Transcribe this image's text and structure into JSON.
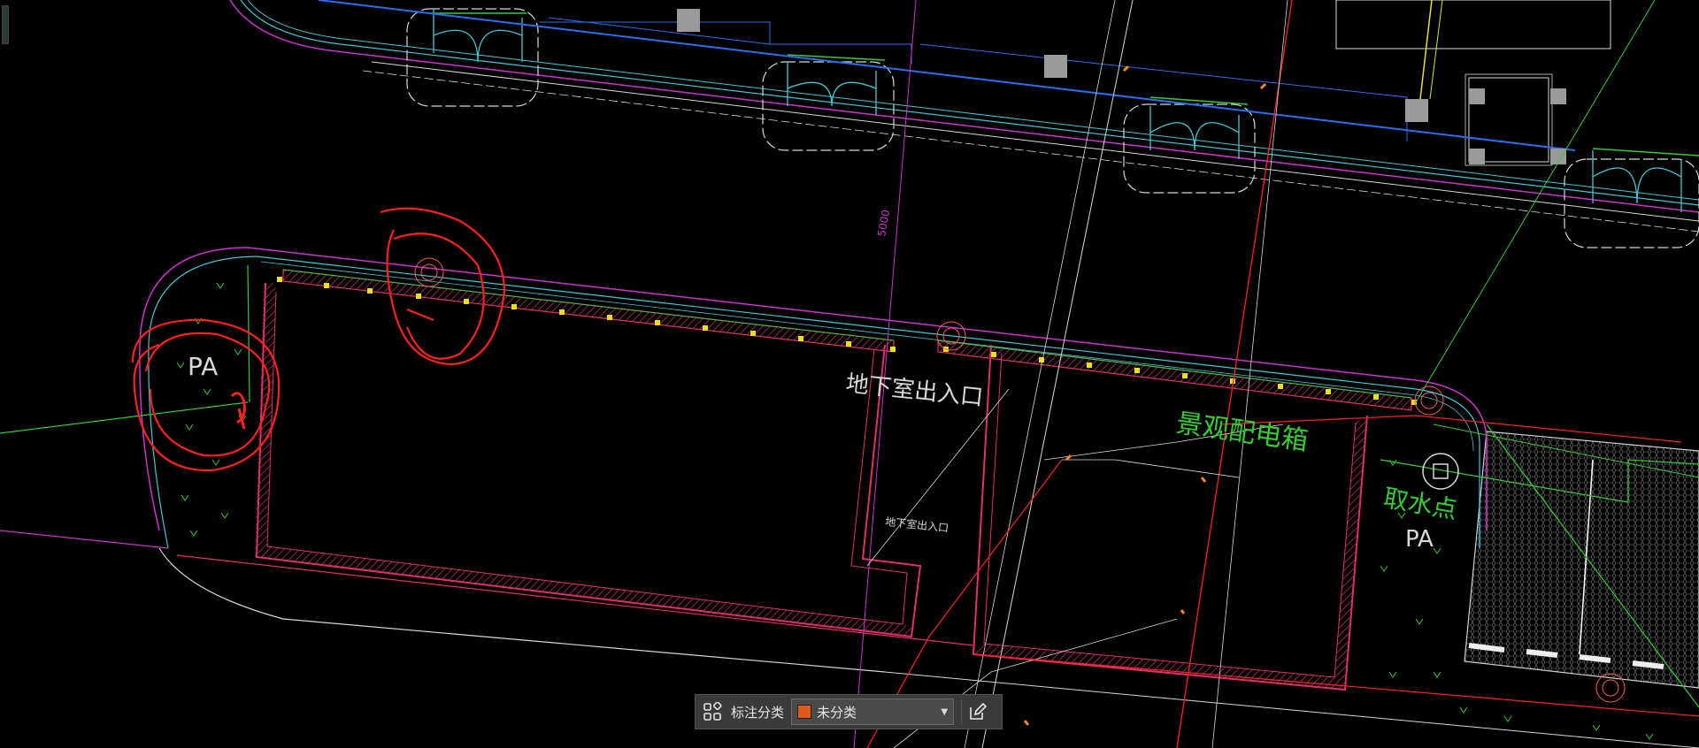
{
  "drawing": {
    "labels": {
      "pa_left": "PA",
      "pa_right": "PA",
      "basement_exit_large": "地下室出入口",
      "basement_exit_small": "地下室出入口",
      "landscape_box": "景观配电箱",
      "water_point": "取水点",
      "dimension": "5000"
    },
    "colors": {
      "background": "#000000",
      "wall_pink": "#e0306a",
      "magenta": "#cc33cc",
      "cyan": "#40c8d8",
      "green": "#33cc33",
      "red": "#ff2020",
      "white": "#d8d8d8",
      "blue": "#2a6ef0",
      "yellow": "#e8e020",
      "orange": "#ff8a1a"
    }
  },
  "toolbar": {
    "icon": "annotation-category-icon",
    "label": "标注分类",
    "selected_value": "未分类",
    "selected_color": "#e05a1a",
    "edit_icon": "edit-icon"
  }
}
